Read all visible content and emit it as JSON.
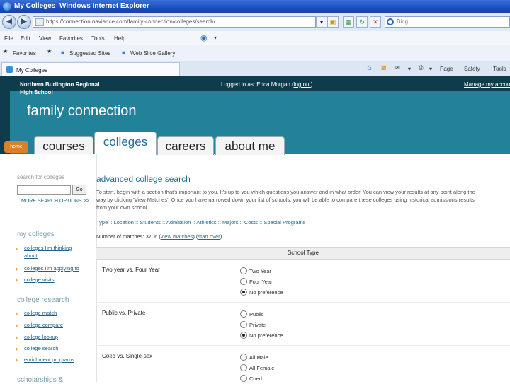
{
  "window": {
    "title": "My Colleges",
    "app": "Windows Internet Explorer",
    "url": "https://connection.naviance.com/family-connection/colleges/search/",
    "search_placeholder": "Bing"
  },
  "menu": [
    "File",
    "Edit",
    "View",
    "Favorites",
    "Tools",
    "Help"
  ],
  "favorites_bar": {
    "favorites": "Favorites",
    "suggested": "Suggested Sites",
    "web_slice": "Web Slice Gallery"
  },
  "browser_tab": {
    "label": "My Colleges"
  },
  "command_bar": {
    "page": "Page",
    "safety": "Safety",
    "tools": "Tools"
  },
  "site": {
    "school_line1": "Northern Burlington Regional",
    "school_line2": "High School",
    "logged_in_prefix": "Logged in as: Erica Morgan (",
    "logout": "log out",
    "logged_in_suffix": ")",
    "manage_account": "Manage my account",
    "brand": "family connection",
    "home": "home",
    "nav_tabs": [
      "courses",
      "colleges",
      "careers",
      "about me"
    ]
  },
  "sidebar": {
    "search_heading": "search for colleges",
    "go": "Go",
    "more_options": "MORE SEARCH OPTIONS >>",
    "my_colleges_heading": "my colleges",
    "my_colleges_links": [
      "colleges I'm thinking",
      "about",
      "colleges I'm applying to",
      "college visits"
    ],
    "research_heading": "college research",
    "research_links": [
      "college match",
      "college compare",
      "college lookup",
      "college search",
      "enrichment programs"
    ],
    "scholarships_heading": "scholarships &"
  },
  "main": {
    "title": "advanced college search",
    "intro_lines": [
      "To start, begin with a section that's important to you. It's up to you which questions you answer and in what order. You can view your results at any point along the",
      "way by clicking 'View Matches'. Once you have narrowed down your list of schools, you will be able to compare these colleges using historical admissions results",
      "from your own school."
    ],
    "type_links": "Type :: Location :: Students :: Admission :: Athletics :: Majors :: Costs :: Special Programs",
    "matches_label": "Number of matches: 3706",
    "view_matches": "view matches",
    "start_over": "start over",
    "table_header": "School Type",
    "questions": [
      {
        "label": "Two year vs. Four Year",
        "options": [
          "Two Year",
          "Four Year",
          "No preference"
        ],
        "selected": 2
      },
      {
        "label": "Public vs. Private",
        "options": [
          "Public",
          "Private",
          "No preference"
        ],
        "selected": 2
      },
      {
        "label": "Coed vs. Single-sex",
        "options": [
          "All Male",
          "All Female",
          "Coed"
        ],
        "selected": -1
      }
    ]
  },
  "colors": {
    "header_teal": "#22829a",
    "header_dark": "#0f3c4c",
    "accent_orange": "#d9802b",
    "link_blue": "#1f6d93"
  }
}
